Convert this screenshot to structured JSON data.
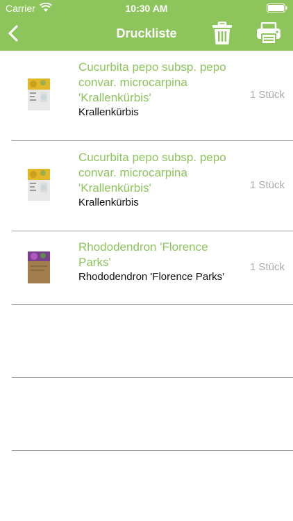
{
  "status_bar": {
    "carrier": "Carrier",
    "time": "10:30 AM"
  },
  "nav": {
    "title": "Druckliste",
    "back_icon": "chevron-left-icon",
    "trash_icon": "trash-icon",
    "print_icon": "printer-icon"
  },
  "items": [
    {
      "botanical": "Cucurbita pepo subsp. pepo convar. microcarpina 'Krallenkürbis'",
      "common": "Krallenkürbis",
      "quantity": "1 Stück",
      "thumb_color": "#e2b72a"
    },
    {
      "botanical": "Cucurbita pepo subsp. pepo convar. microcarpina 'Krallenkürbis'",
      "common": "Krallenkürbis",
      "quantity": "1 Stück",
      "thumb_color": "#e2b72a"
    },
    {
      "botanical": "Rhododendron 'Florence Parks'",
      "common": "Rhododendron 'Florence Parks'",
      "quantity": "1 Stück",
      "thumb_color": "#a27d4e"
    }
  ],
  "colors": {
    "accent": "#8dc45c",
    "divider": "#9e9e9e",
    "quantity_text": "#aaaaaa"
  }
}
